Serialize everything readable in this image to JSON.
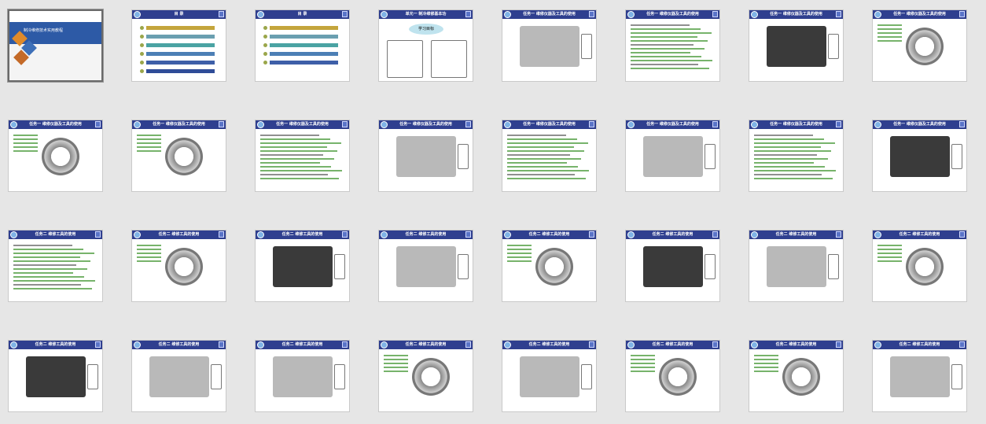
{
  "slides": [
    {
      "header": "",
      "kind": "cover",
      "title": "制冷维修技术实用教程"
    },
    {
      "header": "目  录",
      "kind": "menu"
    },
    {
      "header": "目  录",
      "kind": "menu2"
    },
    {
      "header": "单元一  制冷维修基本功",
      "kind": "bubble",
      "bubble": "学习目标"
    },
    {
      "header": "任务一  维修仪器及工具的使用",
      "kind": "photo"
    },
    {
      "header": "任务一  维修仪器及工具的使用",
      "kind": "text"
    },
    {
      "header": "任务一  维修仪器及工具的使用",
      "kind": "photo"
    },
    {
      "header": "任务一  维修仪器及工具的使用",
      "kind": "gauge"
    },
    {
      "header": "任务一  维修仪器及工具的使用",
      "kind": "gauge"
    },
    {
      "header": "任务一  维修仪器及工具的使用",
      "kind": "gauge"
    },
    {
      "header": "任务一  维修仪器及工具的使用",
      "kind": "text"
    },
    {
      "header": "任务一  维修仪器及工具的使用",
      "kind": "photo"
    },
    {
      "header": "任务一  维修仪器及工具的使用",
      "kind": "text"
    },
    {
      "header": "任务一  维修仪器及工具的使用",
      "kind": "photo"
    },
    {
      "header": "任务一  维修仪器及工具的使用",
      "kind": "text"
    },
    {
      "header": "任务一  维修仪器及工具的使用",
      "kind": "photo"
    },
    {
      "header": "任务二  维修工具的使用",
      "kind": "text"
    },
    {
      "header": "任务二  维修工具的使用",
      "kind": "gauge"
    },
    {
      "header": "任务二  维修工具的使用",
      "kind": "photo"
    },
    {
      "header": "任务二  维修工具的使用",
      "kind": "photo"
    },
    {
      "header": "任务二  维修工具的使用",
      "kind": "gauge"
    },
    {
      "header": "任务二  维修工具的使用",
      "kind": "photo"
    },
    {
      "header": "任务二  维修工具的使用",
      "kind": "photo"
    },
    {
      "header": "任务二  维修工具的使用",
      "kind": "gauge"
    },
    {
      "header": "任务二  维修工具的使用",
      "kind": "photo"
    },
    {
      "header": "任务二  维修工具的使用",
      "kind": "photo"
    },
    {
      "header": "任务二  维修工具的使用",
      "kind": "photo"
    },
    {
      "header": "任务二  维修工具的使用",
      "kind": "gauge"
    },
    {
      "header": "任务二  维修工具的使用",
      "kind": "photo"
    },
    {
      "header": "任务二  维修工具的使用",
      "kind": "gauge"
    },
    {
      "header": "任务二  维修工具的使用",
      "kind": "gauge"
    },
    {
      "header": "任务二  维修工具的使用",
      "kind": "photo"
    }
  ],
  "colors": {
    "header_bg": "#2f3f8f",
    "background": "#e6e6e6",
    "caption": "#c0392b"
  }
}
